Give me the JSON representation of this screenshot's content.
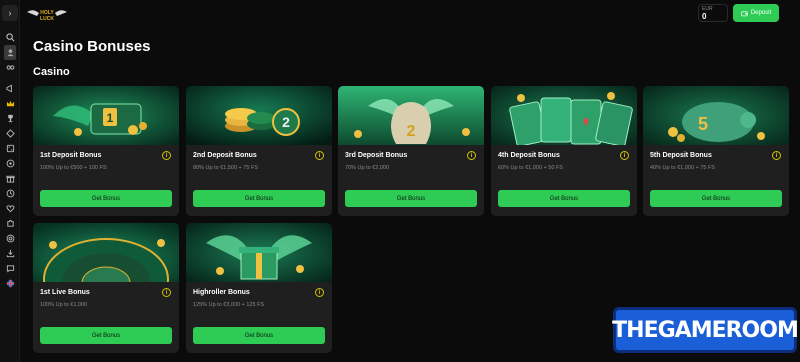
{
  "header": {
    "logo_text": "HOLY LUCK",
    "balance_currency": "EUR",
    "balance_amount": "0",
    "deposit_label": "Deposit"
  },
  "sidebar": {
    "toggle": "›",
    "icons": [
      "search-icon",
      "user-icon",
      "glasses-icon",
      "megaphone-icon",
      "crown-icon",
      "trophy-icon",
      "diamond-icon",
      "dice-icon",
      "soccer-icon",
      "gift-icon",
      "clock-icon",
      "heart-icon",
      "puzzle-icon",
      "support-icon",
      "download-icon",
      "chat-icon",
      "flag-uk-icon"
    ]
  },
  "page": {
    "title": "Casino Bonuses",
    "section": "Casino"
  },
  "cards": [
    {
      "name": "1st Deposit Bonus",
      "desc": "100% Up to €500 + 100 FS",
      "button": "Get Bonus",
      "info": "i",
      "art": "wings-1"
    },
    {
      "name": "2nd Deposit Bonus",
      "desc": "80% Up to €1,500 + 75 FS",
      "button": "Get Bonus",
      "info": "i",
      "art": "coins-2"
    },
    {
      "name": "3rd Deposit Bonus",
      "desc": "70% Up to €2,000",
      "button": "Get Bonus",
      "info": "i",
      "art": "bag-3"
    },
    {
      "name": "4th Deposit Bonus",
      "desc": "60% Up to €1,000 + 50 FS",
      "button": "Get Bonus",
      "info": "i",
      "art": "cards-4"
    },
    {
      "name": "5th Deposit Bonus",
      "desc": "40% Up to €1,000 + 75 FS",
      "button": "Get Bonus",
      "info": "i",
      "art": "pig-5"
    },
    {
      "name": "1st Live Bonus",
      "desc": "100% Up to €1,000",
      "button": "Get Bonus",
      "info": "i",
      "art": "roulette"
    },
    {
      "name": "Highroller Bonus",
      "desc": "125% Up to €3,000 + 125 FS",
      "button": "Get Bonus",
      "info": "i",
      "art": "gift-wings"
    }
  ],
  "watermark": "THEGAMEROOM",
  "colors": {
    "accent": "#2ecc55",
    "card": "#1f1f1f",
    "bg": "#0b0b0b",
    "info": "#d4c400"
  }
}
